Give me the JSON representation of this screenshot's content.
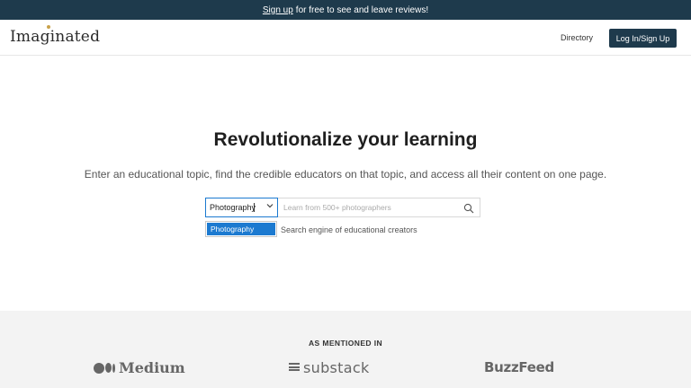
{
  "banner": {
    "link_text": "Sign up",
    "rest_text": "for free to see and leave reviews!"
  },
  "header": {
    "logo": "Imaginated",
    "nav_directory": "Directory",
    "login_label": "Log In/Sign Up"
  },
  "hero": {
    "title": "Revolutionalize your learning",
    "subtitle": "Enter an educational topic, find the credible educators on that topic, and access all their content on one page."
  },
  "search": {
    "topic_value": "Photography",
    "placeholder": "Learn from 500+ photographers",
    "dropdown_options": [
      "Photography"
    ],
    "tagline": "Search engine of educational creators",
    "search_icon": "search-icon",
    "chevron_icon": "chevron-down-icon"
  },
  "mentions": {
    "title": "AS MENTIONED IN",
    "brands": [
      "Medium",
      "substack",
      "BuzzFeed"
    ]
  },
  "colors": {
    "brand_dark": "#1e3a4c",
    "select_blue": "#1c7ad0",
    "mentions_bg": "#f3f3f3",
    "logo_accent": "#c9a24a"
  }
}
